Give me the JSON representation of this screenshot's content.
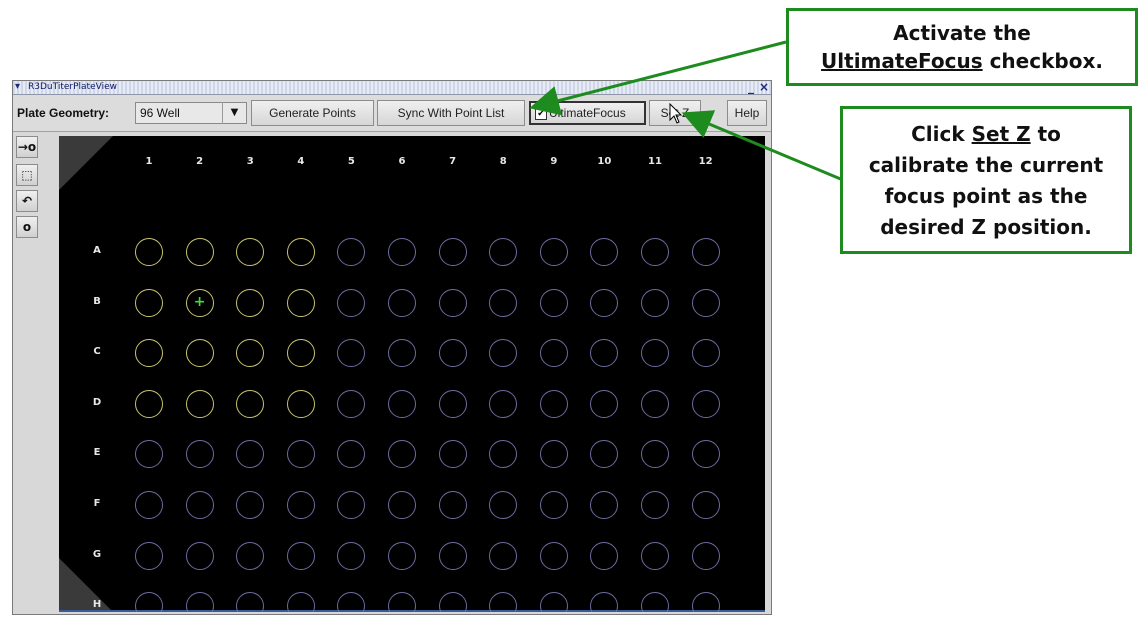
{
  "window": {
    "title": "R3DuTiterPlateView",
    "minimize_glyph": "_",
    "close_glyph": "×",
    "menu_icon": "chevron-down-icon"
  },
  "toolbar": {
    "plate_geometry_label": "Plate Geometry:",
    "plate_geometry_value": "96 Well",
    "dropdown_glyph": "▼",
    "generate_points_label": "Generate Points",
    "sync_label": "Sync With Point List",
    "ultimate_focus_label": "UltimateFocus",
    "ultimate_focus_checked": true,
    "set_z_label": "Set Z",
    "help_label": "Help"
  },
  "tools": [
    {
      "name": "add-point-tool",
      "icon": "arrow-circle-icon",
      "glyph": "→o"
    },
    {
      "name": "select-tool",
      "icon": "select-cursor-icon",
      "glyph": "⬚"
    },
    {
      "name": "undo-tool",
      "icon": "undo-icon",
      "glyph": "↶"
    },
    {
      "name": "point-tool",
      "icon": "circle-icon",
      "glyph": "o"
    }
  ],
  "plate": {
    "columns": [
      "1",
      "2",
      "3",
      "4",
      "5",
      "6",
      "7",
      "8",
      "9",
      "10",
      "11",
      "12"
    ],
    "rows": [
      "A",
      "B",
      "C",
      "D",
      "E",
      "F",
      "G",
      "H"
    ],
    "selected_wells": [
      "A1",
      "A2",
      "A3",
      "A4",
      "B1",
      "B2",
      "B3",
      "B4",
      "C1",
      "C2",
      "C3",
      "C4",
      "D1",
      "D2",
      "D3",
      "D4"
    ],
    "current_well": "B2",
    "colors": {
      "background": "#000000",
      "selected_well": "#c8c46e",
      "unselected_well": "#6c6ca0",
      "current_marker": "#3ae03a"
    }
  },
  "callouts": {
    "top": {
      "line1": "Activate the",
      "underlined": "UltimateFocus",
      "line2_rest": " checkbox."
    },
    "right": {
      "prefix": "Click ",
      "underlined": "Set Z",
      "suffix": " to",
      "line2": "calibrate the current",
      "line3": "focus point as the",
      "line4": "desired Z position."
    },
    "border_color": "#1e8b1e"
  }
}
